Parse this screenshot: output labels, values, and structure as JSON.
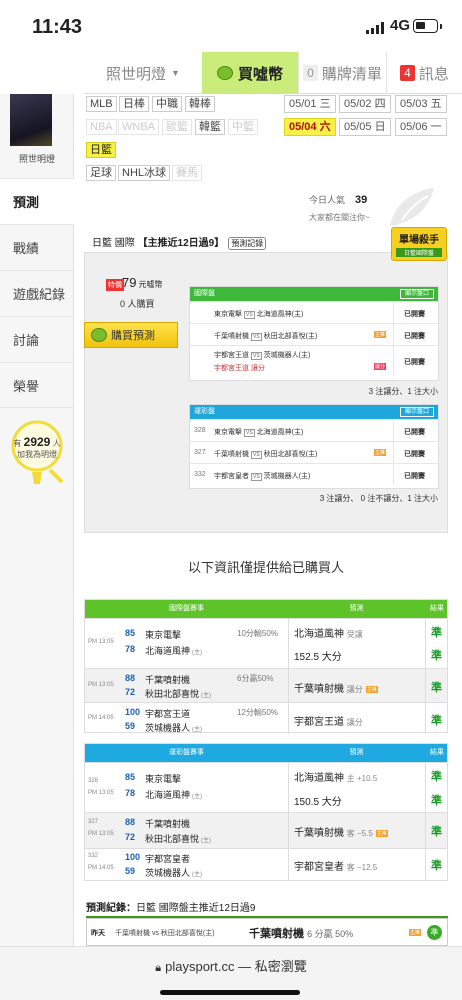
{
  "status": {
    "time": "11:43",
    "network": "4G"
  },
  "topnav": {
    "item1": "照世明燈",
    "buy": "買噓幣",
    "cart_count": "0",
    "cart": "購牌清單",
    "msg_count": "4",
    "msg": "訊息"
  },
  "profile": {
    "name": "照世明燈"
  },
  "sidebar": {
    "items": [
      "預測",
      "戰績",
      "遊戲紀錄",
      "討論",
      "榮譽"
    ],
    "bulb_count": "2929",
    "bulb_prefix": "有",
    "bulb_suffix": "人",
    "bulb_label": "加我為明燈"
  },
  "leagues": {
    "row1": [
      "MLB",
      "日棒",
      "中職",
      "韓棒"
    ],
    "row2": [
      "NBA",
      "WNBA",
      "歐籃",
      "韓籃",
      "中籃"
    ],
    "row3": [
      "日籃"
    ],
    "row4": [
      "足球",
      "NHL冰球",
      "賽馬"
    ]
  },
  "dates": {
    "row1": [
      "05/01 三",
      "05/02 四",
      "05/03 五"
    ],
    "row2": [
      "05/04 六",
      "05/05 日",
      "05/06 一"
    ]
  },
  "stats": {
    "popular_label": "今日人氣",
    "popular_value": "39",
    "follow_text": "大家都在關注你~"
  },
  "card": {
    "title_prefix": "日籃 國際",
    "title_bold": "【主推近12日過9】",
    "record_btn": "預測記錄",
    "badge_title": "單場殺手",
    "badge_sub": "日籃國際盤",
    "price_tag": "特價",
    "price": "79",
    "price_unit": "元噓幣",
    "buyers": "0 人購買",
    "buy_button": "購買預測",
    "intl_head": "國際盤",
    "show_btn": "顯示盤口",
    "intl_rows": [
      {
        "home": "東京電擊",
        "away": "北海道風神(主)",
        "status": "已開賽",
        "tag": ""
      },
      {
        "home": "千葉噴射機",
        "away": "秋田北部喜悅(主)",
        "status": "已開賽",
        "tag": "主推"
      },
      {
        "home": "宇都宮王道",
        "away": "茨城機器人(主)",
        "status": "已開賽",
        "tag": "讓分",
        "sub": "宇都宮王道  讓分"
      }
    ],
    "intl_summary": "3 注讓分、1 注大小",
    "tw_head": "運彩盤",
    "tw_rows": [
      {
        "no": "328",
        "home": "東京電擊",
        "away": "北海道風神(主)",
        "status": "已開賽",
        "tag": ""
      },
      {
        "no": "327",
        "home": "千葉噴射機",
        "away": "秋田北部喜悅(主)",
        "status": "已開賽",
        "tag": "主推"
      },
      {
        "no": "332",
        "home": "宇都宮皇者",
        "away": "茨城機器人(主)",
        "status": "已開賽",
        "tag": ""
      }
    ],
    "tw_summary": "3 注讓分、 0 注不讓分、1 注大小"
  },
  "info_text": "以下資訊僅提供給已購買人",
  "intl_table": {
    "h1": "國際盤賽事",
    "h2": "預測",
    "h3": "結果",
    "rows": [
      {
        "time": "PM 13:05",
        "n1": "85",
        "t1": "東京電擊",
        "n2": "78",
        "t2": "北海道風神",
        "spread": "10分輸50%",
        "p1": "北海道風神",
        "p1s": "受讓",
        "p2": "152.5 大分",
        "p2s": "",
        "r1": "準",
        "r2": "準"
      },
      {
        "time": "PM 13:05",
        "n1": "88",
        "t1": "千葉噴射機",
        "n2": "72",
        "t2": "秋田北部喜悅",
        "spread": "6分贏50%",
        "p1": "千葉噴射機",
        "p1s": "讓分",
        "r1": "準"
      },
      {
        "time": "PM 14:05",
        "n1": "100",
        "t1": "宇都宮王道",
        "n2": "59",
        "t2": "茨城機器人",
        "spread": "12分輸50%",
        "p1": "宇都宮王道",
        "p1s": "讓分",
        "r1": "準"
      }
    ]
  },
  "tw_table": {
    "h1": "運彩盤賽事",
    "h2": "預測",
    "h3": "結果",
    "rows": [
      {
        "no": "328",
        "time": "PM 13:05",
        "n1": "85",
        "t1": "東京電擊",
        "n2": "78",
        "t2": "北海道風神",
        "p1": "北海道風神",
        "p1s": "主 +10.5",
        "p2": "150.5 大分",
        "r1": "準",
        "r2": "準"
      },
      {
        "no": "327",
        "time": "PM 13:05",
        "n1": "88",
        "t1": "千葉噴射機",
        "n2": "72",
        "t2": "秋田北部喜悅",
        "p1": "千葉噴射機",
        "p1s": "客 −5.5",
        "r1": "準"
      },
      {
        "no": "332",
        "time": "PM 14:05",
        "n1": "100",
        "t1": "宇都宮皇者",
        "n2": "59",
        "t2": "茨城機器人",
        "p1": "宇都宮皇者",
        "p1s": "客 −12.5",
        "r1": "準"
      }
    ]
  },
  "record": {
    "title_prefix": "預測紀錄：",
    "title": "日籃 國際盤主推近12日過9",
    "day": "昨天",
    "match": "千葉噴射機 vs 秋田北部喜悅(主)",
    "pick": "千葉噴射機",
    "pick_sub": "6 分贏 50%",
    "result": "準"
  },
  "browser": {
    "url": "playsport.cc — 私密瀏覽"
  }
}
